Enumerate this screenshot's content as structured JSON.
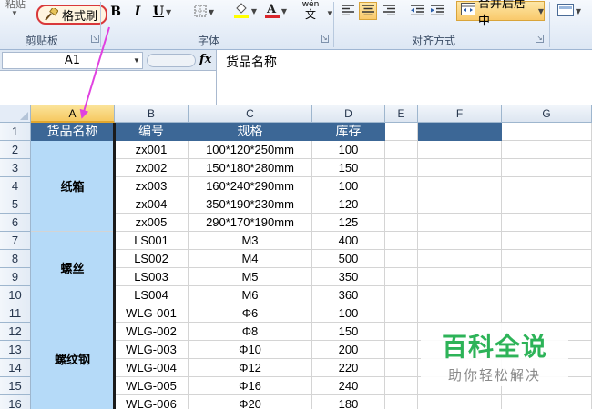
{
  "ribbon": {
    "paste_label": "粘贴",
    "format_painter_label": "格式刷",
    "groups": {
      "clipboard": "剪贴板",
      "font": "字体",
      "alignment": "对齐方式"
    },
    "bold": "B",
    "italic": "I",
    "underline": "U",
    "phonetic": "wén",
    "merge_center_label": "合并后居中",
    "font_color": "#d9262c",
    "fill_color": "#ffff00",
    "accent_highlight": "#d9383a"
  },
  "formula_bar": {
    "name_box": "A1",
    "fx": "fx",
    "content": "货品名称"
  },
  "grid": {
    "columns": [
      "A",
      "B",
      "C",
      "D",
      "E",
      "F",
      "G"
    ],
    "rows": [
      "1",
      "2",
      "3",
      "4",
      "5",
      "6",
      "7",
      "8",
      "9",
      "10",
      "11",
      "12",
      "13",
      "14",
      "15",
      "16"
    ],
    "selected_column": "A",
    "header_fill": "#3c6796",
    "group_fill": "#b5daf8",
    "headers": {
      "a": "货品名称",
      "b": "编号",
      "c": "规格",
      "d": "库存"
    },
    "groups": [
      {
        "name": "纸箱",
        "rows": [
          {
            "code": "zx001",
            "spec": "100*120*250mm",
            "stock": "100"
          },
          {
            "code": "zx002",
            "spec": "150*180*280mm",
            "stock": "150"
          },
          {
            "code": "zx003",
            "spec": "160*240*290mm",
            "stock": "100"
          },
          {
            "code": "zx004",
            "spec": "350*190*230mm",
            "stock": "120"
          },
          {
            "code": "zx005",
            "spec": "290*170*190mm",
            "stock": "125"
          }
        ]
      },
      {
        "name": "螺丝",
        "rows": [
          {
            "code": "LS001",
            "spec": "M3",
            "stock": "400"
          },
          {
            "code": "LS002",
            "spec": "M4",
            "stock": "500"
          },
          {
            "code": "LS003",
            "spec": "M5",
            "stock": "350"
          },
          {
            "code": "LS004",
            "spec": "M6",
            "stock": "360"
          }
        ]
      },
      {
        "name": "螺纹钢",
        "rows": [
          {
            "code": "WLG-001",
            "spec": "Φ6",
            "stock": "100"
          },
          {
            "code": "WLG-002",
            "spec": "Φ8",
            "stock": "150"
          },
          {
            "code": "WLG-003",
            "spec": "Φ10",
            "stock": "200"
          },
          {
            "code": "WLG-004",
            "spec": "Φ12",
            "stock": "220"
          },
          {
            "code": "WLG-005",
            "spec": "Φ16",
            "stock": "240"
          },
          {
            "code": "WLG-006",
            "spec": "Φ20",
            "stock": "180"
          }
        ]
      }
    ]
  },
  "watermark": {
    "title": "百科全说",
    "subtitle": "助你轻松解决"
  }
}
